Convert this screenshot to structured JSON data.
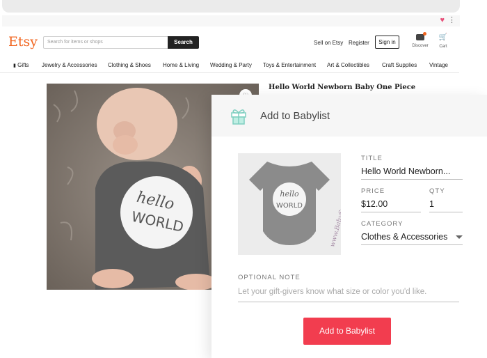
{
  "browser": {
    "menu_icon": "more-vertical-icon",
    "extension_icon": "heart-icon"
  },
  "etsy": {
    "logo": "Etsy",
    "search": {
      "placeholder": "Search for items or shops",
      "button_label": "Search"
    },
    "header": {
      "sell_label": "Sell on Etsy",
      "register_label": "Register",
      "signin_label": "Sign in",
      "discover_label": "Discover",
      "cart_label": "Cart"
    },
    "categories": [
      {
        "label": "Gifts"
      },
      {
        "label": "Jewelry & Accessories"
      },
      {
        "label": "Clothing & Shoes"
      },
      {
        "label": "Home & Living"
      },
      {
        "label": "Wedding & Party"
      },
      {
        "label": "Toys & Entertainment"
      },
      {
        "label": "Art & Collectibles"
      },
      {
        "label": "Craft Supplies"
      },
      {
        "label": "Vintage"
      }
    ],
    "product": {
      "title": "Hello World Newborn Baby One Piece",
      "photo_lettering": [
        "hello",
        "WORLD"
      ]
    }
  },
  "babylist": {
    "title": "Add to Babylist",
    "thumb_lettering": [
      "hello",
      "WORLD"
    ],
    "thumb_watermark": "www.BabySwag.com",
    "fields": {
      "title_label": "TITLE",
      "title_value": "Hello World Newborn...",
      "price_label": "PRICE",
      "price_value": "$12.00",
      "qty_label": "QTY",
      "qty_value": "1",
      "category_label": "CATEGORY",
      "category_value": "Clothes & Accessories",
      "note_label": "OPTIONAL NOTE",
      "note_placeholder": "Let your gift-givers know what size or color you'd like."
    },
    "button_label": "Add to Babylist",
    "colors": {
      "button": "#f23d4f",
      "header_bg": "#f6f6f6",
      "gift_icon": "#7fcfc0"
    }
  }
}
